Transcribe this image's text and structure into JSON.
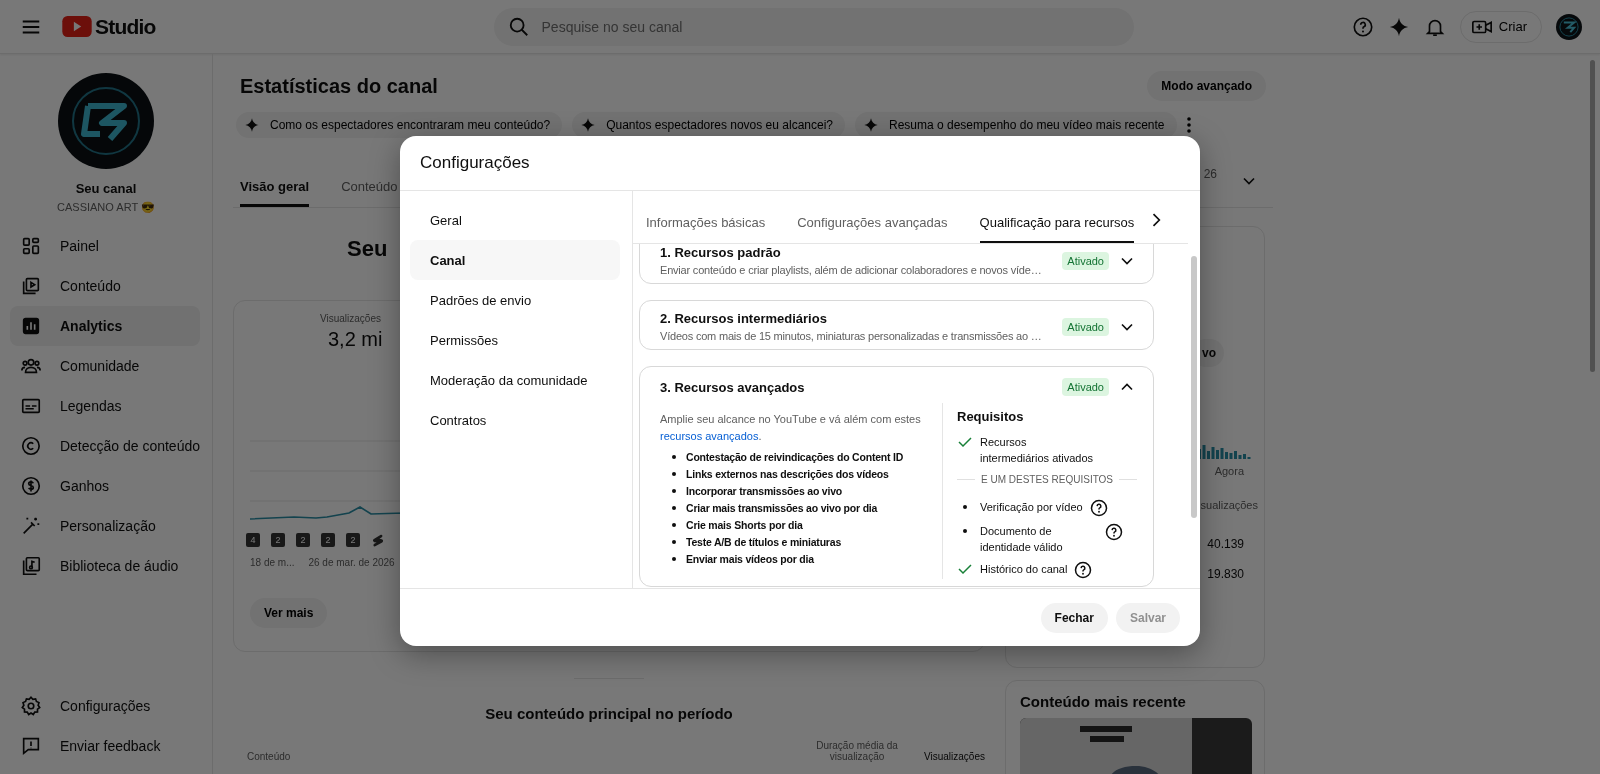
{
  "topbar": {
    "logo": "Studio",
    "search": {
      "placeholder": "Pesquise no seu canal"
    },
    "create_button": "Criar"
  },
  "sidebar": {
    "channel_title": "Seu canal",
    "channel_name": "CASSIANO ART 😎",
    "items": [
      {
        "label": "Painel",
        "selected": false
      },
      {
        "label": "Conteúdo",
        "selected": false
      },
      {
        "label": "Analytics",
        "selected": true
      },
      {
        "label": "Comunidade",
        "selected": false
      },
      {
        "label": "Legendas",
        "selected": false
      },
      {
        "label": "Detecção de conteúdo",
        "selected": false
      },
      {
        "label": "Ganhos",
        "selected": false
      },
      {
        "label": "Personalização",
        "selected": false
      },
      {
        "label": "Biblioteca de áudio",
        "selected": false
      }
    ],
    "bottom_items": [
      {
        "label": "Configurações"
      },
      {
        "label": "Enviar feedback"
      }
    ]
  },
  "main": {
    "title": "Estatísticas do canal",
    "advanced_button": "Modo avançado",
    "chips": [
      "Como os espectadores encontraram meu conteúdo?",
      "Quantos espectadores novos eu alcancei?",
      "Resuma o desempenho do meu vídeo mais recente"
    ],
    "tabs": [
      {
        "label": "Visão geral",
        "selected": true
      },
      {
        "label": "Conteúdo",
        "selected": false
      }
    ],
    "date_fragment": "26",
    "headline_fragment": "Seu",
    "views_card": {
      "label": "Visualizações",
      "value": "3,2 mi",
      "markers": [
        "4",
        "2",
        "2",
        "2",
        "2"
      ],
      "dates": [
        "18 de m...",
        "26 de mar. de 2026"
      ],
      "more_button": "Ver mais"
    },
    "side_card": {
      "chip_fragment": "vo",
      "axis_label": "Agora",
      "column_fragment": "sualizações",
      "values": [
        "40.139",
        "19.830"
      ]
    },
    "top_content": {
      "title": "Seu conteúdo principal no período",
      "columns": [
        "Conteúdo",
        "Duração média da visualização",
        "Visualizações"
      ]
    },
    "latest": {
      "title": "Conteúdo mais recente"
    }
  },
  "dialog": {
    "title": "Configurações",
    "nav": [
      {
        "label": "Geral",
        "selected": false
      },
      {
        "label": "Canal",
        "selected": true
      },
      {
        "label": "Padrões de envio",
        "selected": false
      },
      {
        "label": "Permissões",
        "selected": false
      },
      {
        "label": "Moderação da comunidade",
        "selected": false
      },
      {
        "label": "Contratos",
        "selected": false
      }
    ],
    "tabs": [
      {
        "label": "Informações básicas",
        "selected": false
      },
      {
        "label": "Configurações avançadas",
        "selected": false
      },
      {
        "label": "Qualificação para recursos",
        "selected": true
      }
    ],
    "sections": [
      {
        "title": "1. Recursos padrão",
        "description": "Enviar conteúdo e criar playlists, além de adicionar colaboradores e novos víde…",
        "status": "Ativado",
        "expanded": false
      },
      {
        "title": "2. Recursos intermediários",
        "description": "Vídeos com mais de 15 minutos, miniaturas personalizadas e transmissões ao …",
        "status": "Ativado",
        "expanded": false
      },
      {
        "title": "3. Recursos avançados",
        "status": "Ativado",
        "expanded": true,
        "intro_before": "Amplie seu alcance no YouTube e vá além com estes",
        "intro_link": "recursos avançados",
        "intro_after": ".",
        "features": [
          "Contestação de reivindicações do Content ID",
          "Links externos nas descrições dos vídeos",
          "Incorporar transmissões ao vivo",
          "Criar mais transmissões ao vivo por dia",
          "Crie mais Shorts por dia",
          "Teste A/B de títulos e miniaturas",
          "Enviar mais vídeos por dia"
        ],
        "requirements_title": "Requisitos",
        "requirements": [
          {
            "kind": "met",
            "label": "Recursos intermediários ativados",
            "help": false
          },
          {
            "kind": "divider",
            "label": "E UM DESTES REQUISITOS"
          },
          {
            "kind": "option",
            "label": "Verificação por vídeo",
            "help": true
          },
          {
            "kind": "option",
            "label": "Documento de identidade válido",
            "help": true
          },
          {
            "kind": "met",
            "label": "Histórico do canal",
            "help": true
          }
        ]
      }
    ],
    "buttons": [
      {
        "label": "Fechar",
        "disabled": false
      },
      {
        "label": "Salvar",
        "disabled": true
      }
    ]
  }
}
